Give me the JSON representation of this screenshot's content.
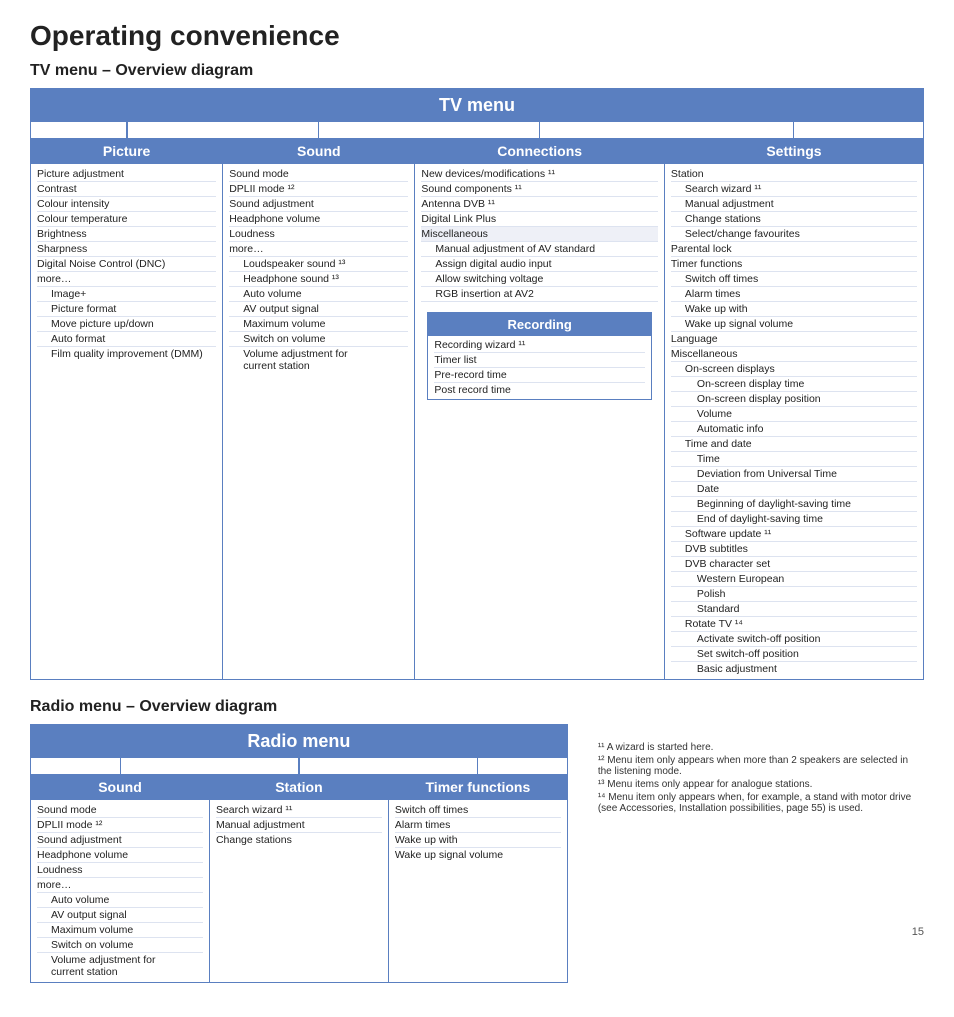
{
  "page": {
    "title": "Operating convenience",
    "section1": "TV menu – Overview diagram",
    "section2": "Radio menu – Overview diagram",
    "page_number": "15"
  },
  "tv_menu": {
    "header": "TV menu",
    "columns": {
      "picture": {
        "header": "Picture",
        "items": [
          "Picture adjustment",
          "Contrast",
          "Colour intensity",
          "Colour temperature",
          "Brightness",
          "Sharpness",
          "Digital Noise Control (DNC)",
          "more…"
        ],
        "subitems": [
          "Image+",
          "Picture format",
          "Move picture up/down",
          "Auto format",
          "Film quality improvement (DMM)"
        ]
      },
      "sound": {
        "header": "Sound",
        "items": [
          "Sound mode",
          "DPLII mode ¹²",
          "Sound adjustment",
          "Headphone volume",
          "Loudness",
          "more…"
        ],
        "subitems": [
          "Loudspeaker sound ¹³",
          "Headphone sound ¹³",
          "Auto volume",
          "AV output signal",
          "Maximum volume",
          "Switch on volume",
          "Volume adjustment for current station"
        ]
      },
      "connections": {
        "header": "Connections",
        "items": [
          "New devices/modifications ¹¹",
          "Sound components ¹¹",
          "Antenna DVB ¹¹",
          "Digital Link Plus"
        ],
        "miscellaneous_header": "Miscellaneous",
        "miscellaneous_items": [
          "Manual adjustment of AV standard",
          "Assign digital audio input",
          "Allow switching voltage",
          "RGB insertion at AV2"
        ],
        "recording": {
          "header": "Recording",
          "items": [
            "Recording wizard ¹¹",
            "Timer list",
            "Pre-record time",
            "Post record time"
          ]
        }
      },
      "settings": {
        "header": "Settings",
        "station_label": "Station",
        "station_items": [
          "Search wizard ¹¹",
          "Manual adjustment",
          "Change stations",
          "Select/change favourites"
        ],
        "parental_lock": "Parental lock",
        "timer_functions": "Timer functions",
        "timer_items": [
          "Switch off times",
          "Alarm times",
          "Wake up with",
          "Wake up signal volume"
        ],
        "language": "Language",
        "miscellaneous": "Miscellaneous",
        "misc_items": [
          "On-screen displays",
          "On-screen display time",
          "On-screen display position",
          "Volume",
          "Automatic info"
        ],
        "time_and_date": "Time and date",
        "time_items": [
          "Time",
          "Deviation from Universal Time",
          "Date",
          "Beginning of daylight-saving time",
          "End of daylight-saving time"
        ],
        "software_update": "Software update ¹¹",
        "dvb_subtitles": "DVB subtitles",
        "dvb_character_set": "DVB character set",
        "dvb_char_items": [
          "Western European",
          "Polish",
          "Standard"
        ],
        "rotate_tv": "Rotate TV ¹⁴",
        "rotate_items": [
          "Activate switch-off position",
          "Set switch-off position",
          "Basic adjustment"
        ]
      }
    }
  },
  "radio_menu": {
    "header": "Radio menu",
    "columns": {
      "sound": {
        "header": "Sound",
        "items": [
          "Sound mode",
          "DPLII mode ¹²",
          "Sound adjustment",
          "Headphone volume",
          "Loudness",
          "more…"
        ],
        "subitems": [
          "Auto volume",
          "AV output signal",
          "Maximum volume",
          "Switch on volume",
          "Volume adjustment for current station"
        ]
      },
      "station": {
        "header": "Station",
        "items": [
          "Search wizard ¹¹",
          "Manual adjustment",
          "Change stations"
        ]
      },
      "timer_functions": {
        "header": "Timer functions",
        "items": [
          "Switch off times",
          "Alarm times",
          "Wake up with",
          "Wake up signal volume"
        ]
      }
    }
  },
  "footnotes": {
    "f1": "¹¹  A wizard is started here.",
    "f2": "¹²  Menu item only appears when more than 2 speakers are selected in the listening mode.",
    "f3": "¹³  Menu items only appear for analogue stations.",
    "f4": "¹⁴  Menu item only appears when, for example, a stand with motor drive (see Accessories, Installation possibilities, page 55) is used."
  }
}
